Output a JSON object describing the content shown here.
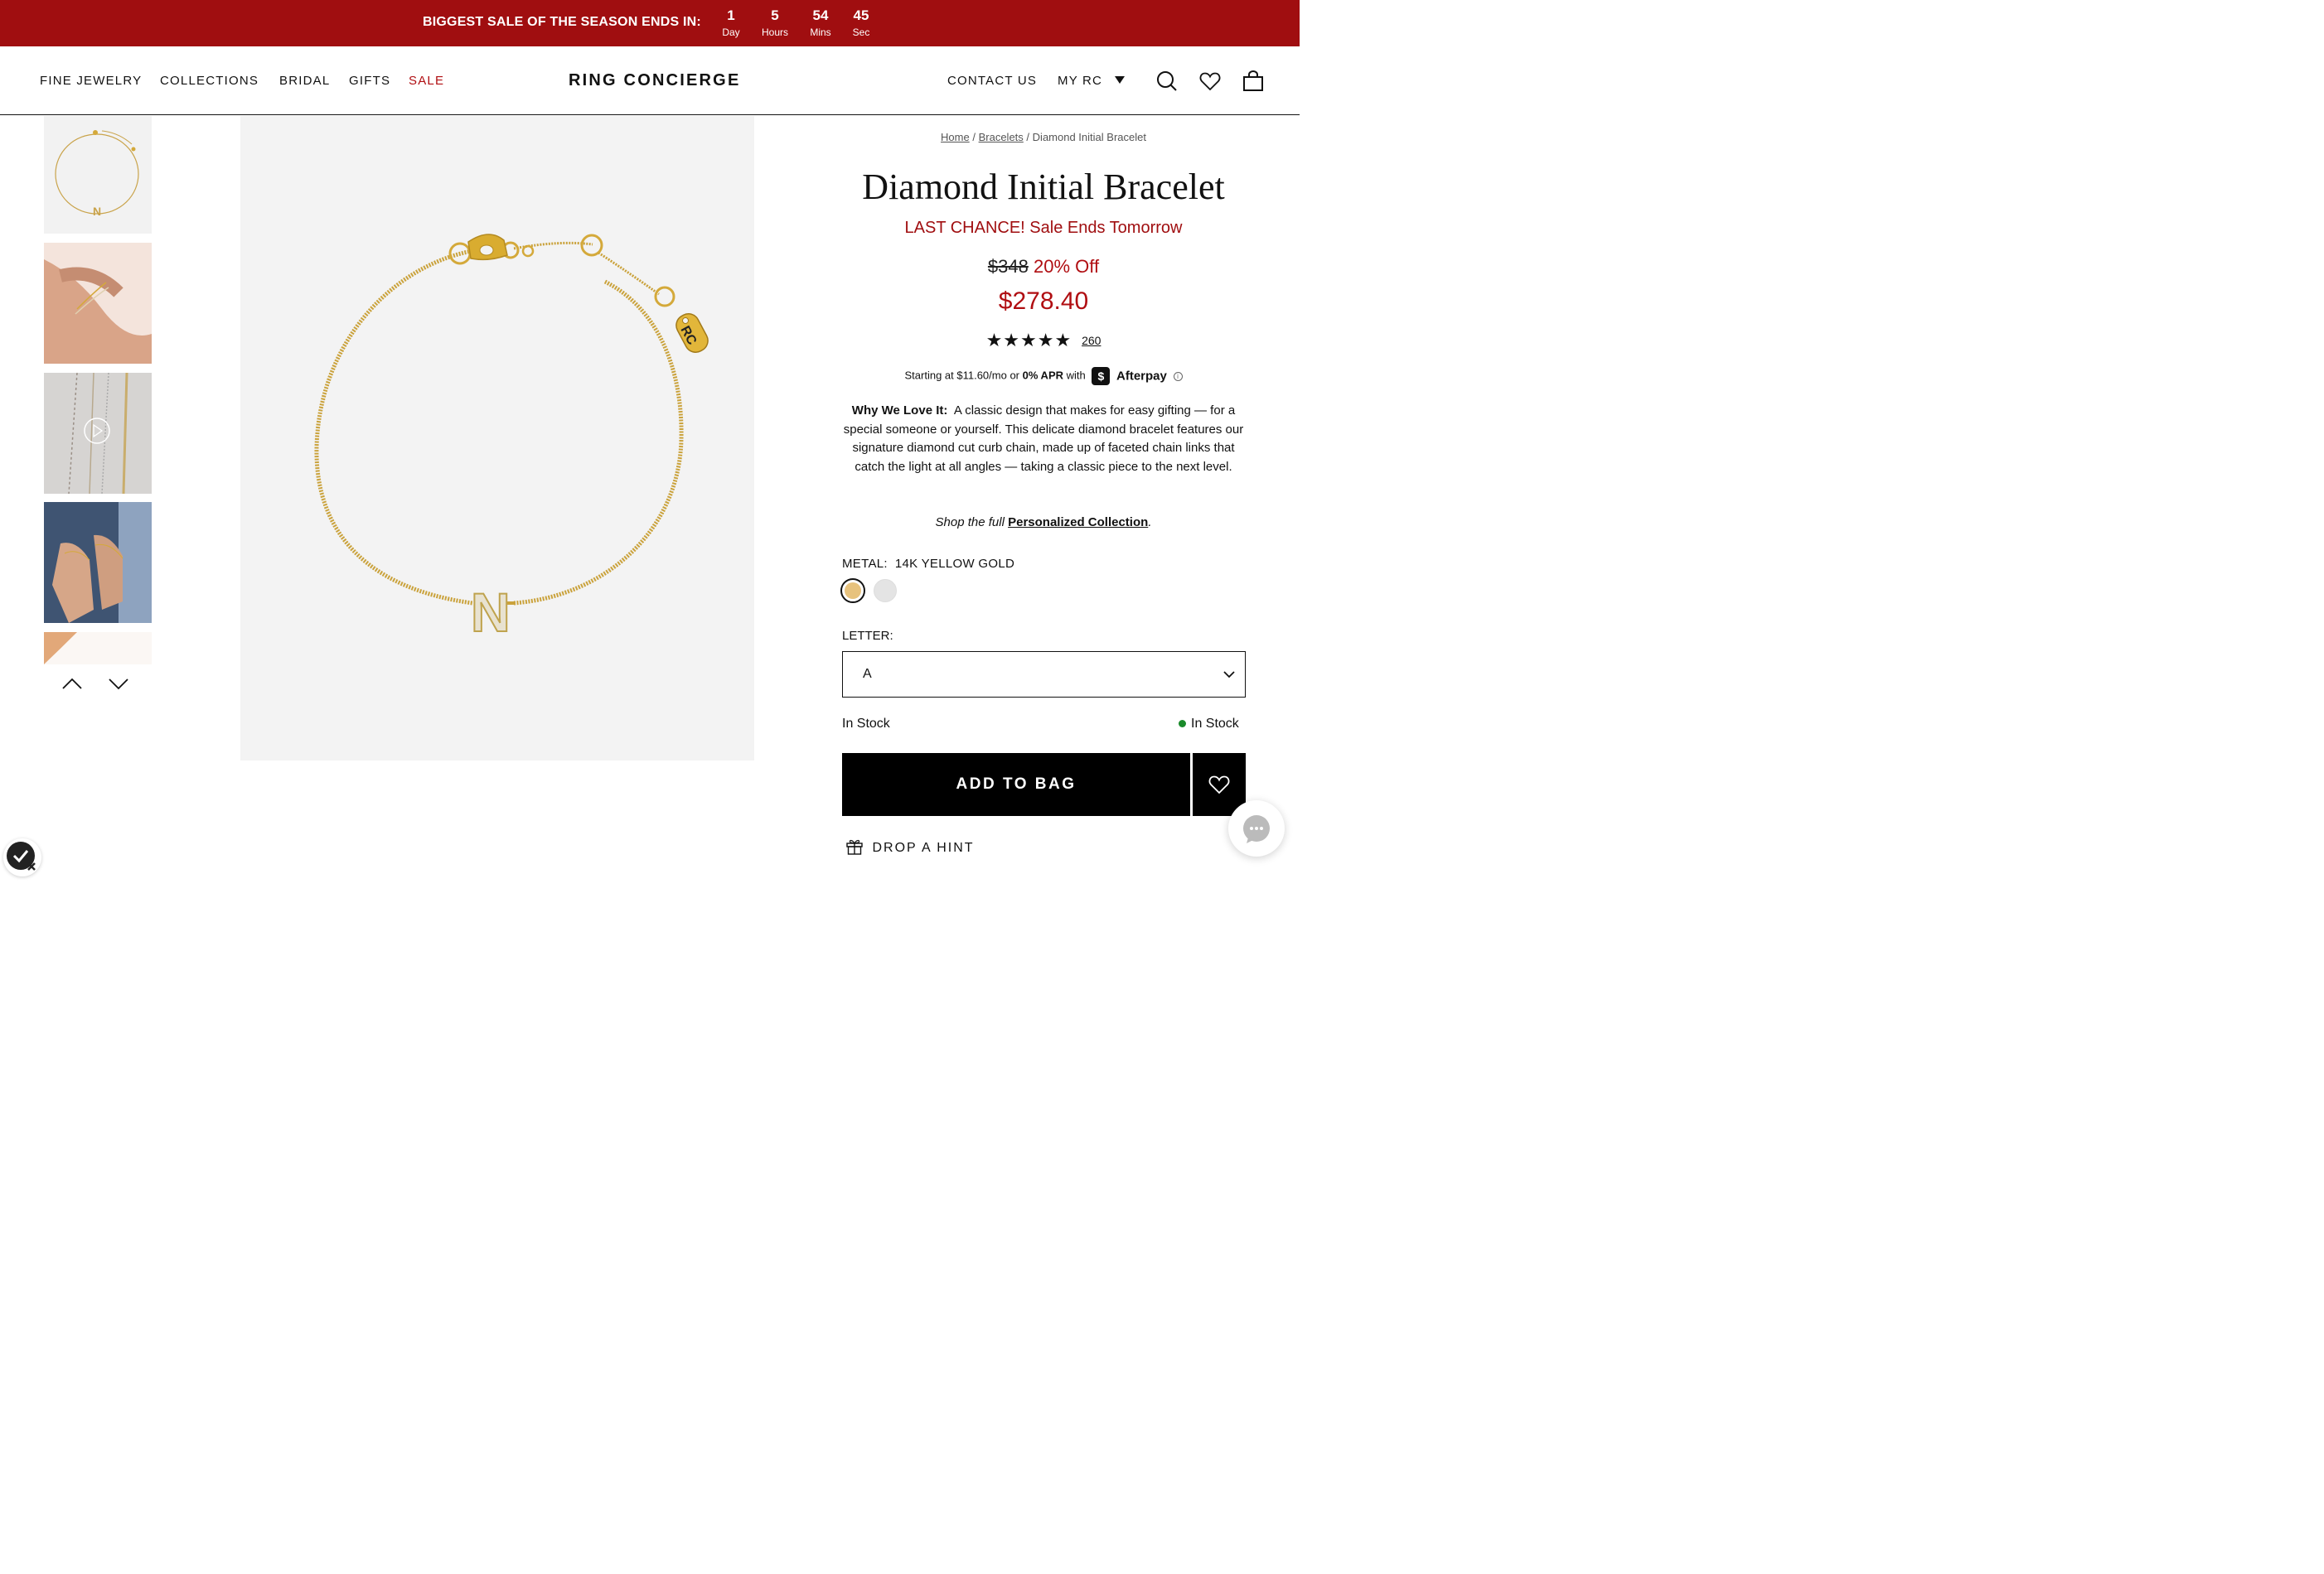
{
  "promo": {
    "text": "BIGGEST SALE OF THE SEASON ENDS IN:",
    "countdown": [
      {
        "value": "1",
        "label": "Day"
      },
      {
        "value": "5",
        "label": "Hours"
      },
      {
        "value": "54",
        "label": "Mins"
      },
      {
        "value": "45",
        "label": "Sec"
      }
    ]
  },
  "nav": {
    "left": [
      "FINE JEWELRY",
      "COLLECTIONS",
      "BRIDAL",
      "GIFTS",
      "SALE"
    ],
    "logo": "RING CONCIERGE",
    "contact": "CONTACT US",
    "account": "MY RC",
    "icons": [
      "search-icon",
      "heart-icon",
      "bag-icon"
    ]
  },
  "gallery": {
    "thumbnails": [
      "bracelet-product",
      "bracelet-on-wrist",
      "bracelet-video",
      "bracelets-on-wrists",
      "bracelet-detail"
    ]
  },
  "breadcrumb": {
    "home": "Home",
    "sep": "/",
    "category": "Bracelets",
    "current": "Diamond Initial Bracelet"
  },
  "product": {
    "title": "Diamond Initial Bracelet",
    "urgency": "LAST CHANCE! Sale Ends Tomorrow",
    "old_price": "$348",
    "discount": "20% Off",
    "sale_price": "$278.40",
    "stars": "★★★★★",
    "rating_value": 5,
    "review_count": "260",
    "afterpay": {
      "starting": "Starting at $11.60/mo or",
      "apr": "0% APR",
      "with": "with",
      "badge": "$",
      "brand": "Afterpay",
      "info": "i"
    },
    "description_lead": "Why We Love It:",
    "description": "A classic design that makes for easy gifting — for a special someone or yourself. This delicate diamond bracelet features our signature diamond cut curb chain, made up of faceted chain links that catch the light at all angles — taking a classic piece to the next level.",
    "shop_prefix": "Shop the full",
    "shop_link": "Personalized Collection",
    "shop_suffix": ".",
    "metal_label": "METAL:",
    "metal_value": "14K YELLOW GOLD",
    "metal_swatches": [
      {
        "name": "yellow-gold",
        "color": "#e7c27d",
        "selected": true
      },
      {
        "name": "white-gold",
        "color": "#e4e4e4",
        "selected": false
      }
    ],
    "letter_label": "LETTER:",
    "letter_value": "A",
    "stock_left": "In Stock",
    "stock_right": "In Stock",
    "add_to_bag": "ADD TO BAG",
    "drop_hint": "DROP A HINT",
    "charm_letter": "N",
    "tag_text": "RC"
  },
  "colors": {
    "promo_bg": "#a00e10",
    "sale_red": "#b00e12",
    "gold": "#d4a93a",
    "stock_green": "#1a8a2a"
  }
}
